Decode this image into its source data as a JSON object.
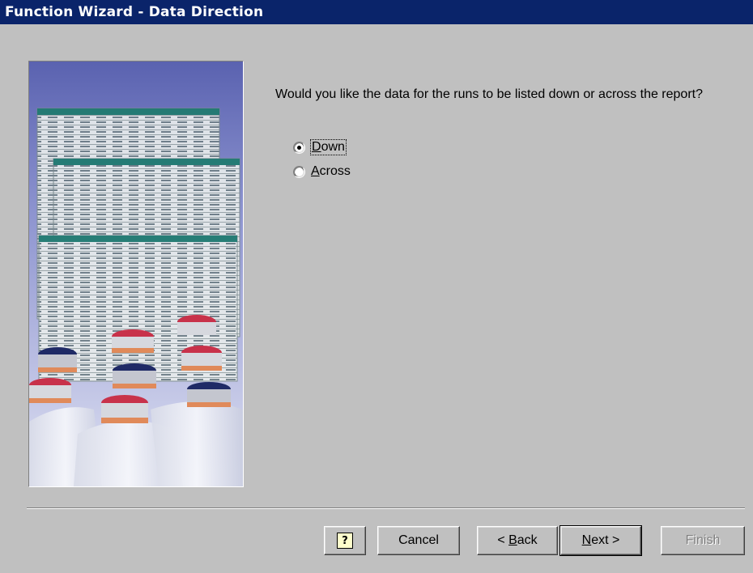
{
  "window": {
    "title": "Function Wizard - Data Direction"
  },
  "image": {
    "description_icon": "lab-vials-spreadsheet-illustration"
  },
  "question": {
    "text": "Would you like the data for the runs to be listed down or across the report?"
  },
  "options": [
    {
      "label": "Down",
      "accel": "D",
      "rest": "own",
      "selected": true
    },
    {
      "label": "Across",
      "accel": "A",
      "rest": "cross",
      "selected": false
    }
  ],
  "buttons": {
    "help_glyph": "?",
    "cancel": "Cancel",
    "back_prefix": "< ",
    "back_accel": "B",
    "back_rest": "ack",
    "next_accel": "N",
    "next_rest": "ext >",
    "finish": "Finish"
  },
  "colors": {
    "titlebar": "#0a246a",
    "dialog": "#c0c0c0"
  }
}
